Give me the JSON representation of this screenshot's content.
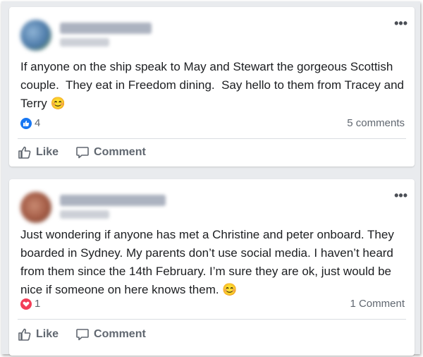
{
  "posts": [
    {
      "text": "If anyone on the ship speak to May and Stewart the gorgeous Scottish couple.  They eat in Freedom dining.  Say hello to them from Tracey and Terry 😊",
      "reaction_icon": "like-icon",
      "reaction_count": "4",
      "comments_label": "5 comments",
      "like_label": "Like",
      "comment_label": "Comment"
    },
    {
      "text": "Just wondering if anyone has met a Christine and peter onboard. They boarded in Sydney. My parents don’t use social media. I haven’t heard from them since the 14th February. I’m sure they are ok, just would be nice if someone on here knows them. 😊",
      "reaction_icon": "heart-icon",
      "reaction_count": "1",
      "comments_label": "1 Comment",
      "like_label": "Like",
      "comment_label": "Comment"
    }
  ],
  "more_label": "•••",
  "colors": {
    "like": "#1877f2",
    "love": "#f33e58",
    "text": "#1c1e21",
    "muted": "#606770"
  }
}
